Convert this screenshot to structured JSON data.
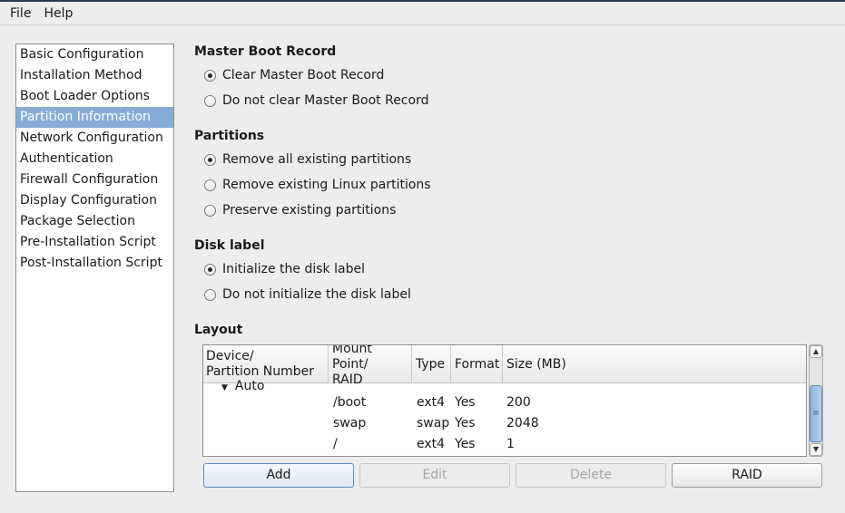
{
  "menubar": {
    "items": [
      "File",
      "Help"
    ]
  },
  "sidebar": {
    "items": [
      {
        "label": "Basic Configuration",
        "selected": false
      },
      {
        "label": "Installation Method",
        "selected": false
      },
      {
        "label": "Boot Loader Options",
        "selected": false
      },
      {
        "label": "Partition Information",
        "selected": true
      },
      {
        "label": "Network Configuration",
        "selected": false
      },
      {
        "label": "Authentication",
        "selected": false
      },
      {
        "label": "Firewall Configuration",
        "selected": false
      },
      {
        "label": "Display Configuration",
        "selected": false
      },
      {
        "label": "Package Selection",
        "selected": false
      },
      {
        "label": "Pre-Installation Script",
        "selected": false
      },
      {
        "label": "Post-Installation Script",
        "selected": false
      }
    ]
  },
  "mbr": {
    "title": "Master Boot Record",
    "options": [
      {
        "label": "Clear Master Boot Record",
        "checked": true
      },
      {
        "label": "Do not clear Master Boot Record",
        "checked": false
      }
    ]
  },
  "partitions": {
    "title": "Partitions",
    "options": [
      {
        "label": "Remove all existing partitions",
        "checked": true
      },
      {
        "label": "Remove existing Linux partitions",
        "checked": false
      },
      {
        "label": "Preserve existing partitions",
        "checked": false
      }
    ]
  },
  "disklabel": {
    "title": "Disk label",
    "options": [
      {
        "label": "Initialize the disk label",
        "checked": true
      },
      {
        "label": "Do not initialize the disk label",
        "checked": false
      }
    ]
  },
  "layout": {
    "title": "Layout",
    "columns": {
      "device_line1": "Device/",
      "device_line2": "Partition Number",
      "mount_line1": "Mount Point/",
      "mount_line2": "RAID",
      "type": "Type",
      "format": "Format",
      "size": "Size (MB)"
    },
    "tree_parent": "Auto",
    "rows": [
      {
        "mount": "/boot",
        "type": "ext4",
        "format": "Yes",
        "size": "200"
      },
      {
        "mount": "swap",
        "type": "swap",
        "format": "Yes",
        "size": "2048"
      },
      {
        "mount": "/",
        "type": "ext4",
        "format": "Yes",
        "size": "1"
      }
    ]
  },
  "buttons": {
    "add": "Add",
    "edit": "Edit",
    "delete": "Delete",
    "raid": "RAID"
  }
}
